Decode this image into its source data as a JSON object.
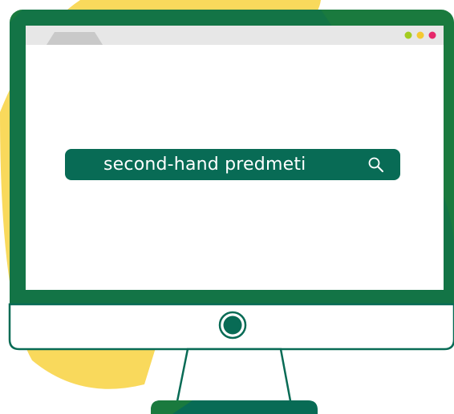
{
  "search": {
    "query": "second-hand predmeti",
    "icon": "search-icon"
  },
  "window": {
    "controls": [
      "green-dot",
      "yellow-dot",
      "pink-dot"
    ],
    "control_colors": [
      "#a3cc1f",
      "#f4c930",
      "#e6286a"
    ]
  },
  "colors": {
    "frame_dark": "#086b55",
    "frame_light": "#1a7a3e",
    "blob": "#f9d95c",
    "titlebar": "#e7e7e7",
    "tab": "#c9c9c9"
  }
}
